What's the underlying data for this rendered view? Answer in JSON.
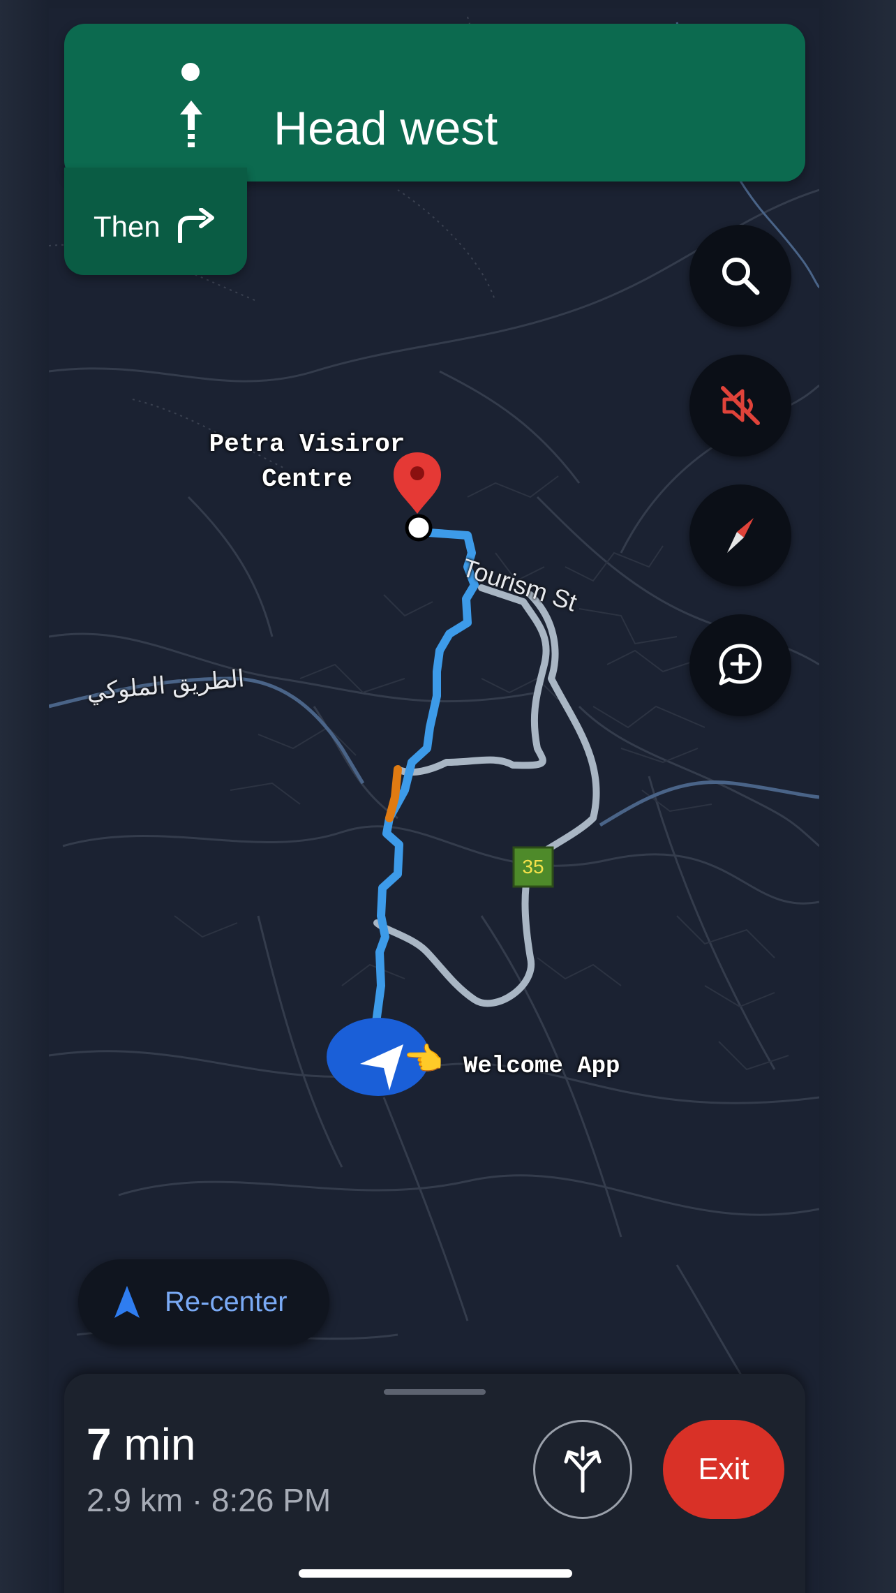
{
  "navigation": {
    "instruction": "Head west",
    "then_label": "Then"
  },
  "map": {
    "destination_label": "Petra Visiror Centre",
    "street_label": "Tourism St",
    "road_label_arabic": "الطريق الملوكي",
    "route_shield": "35",
    "user_label": "Welcome App"
  },
  "controls": {
    "search_icon": "search-icon",
    "mute_icon": "volume-off-icon",
    "compass_icon": "compass-icon",
    "report_icon": "add-report-icon"
  },
  "recenter": {
    "label": "Re-center"
  },
  "trip": {
    "duration_value": "7",
    "duration_unit": "min",
    "details": "2.9 km · 8:26 PM",
    "exit_label": "Exit"
  },
  "colors": {
    "nav_green": "#0c6a4f",
    "route_blue": "#3d9be9",
    "alt_route": "#a9b6c4",
    "traffic_orange": "#e07b12",
    "exit_red": "#d93127",
    "recenter_blue": "#7aaaf5"
  }
}
